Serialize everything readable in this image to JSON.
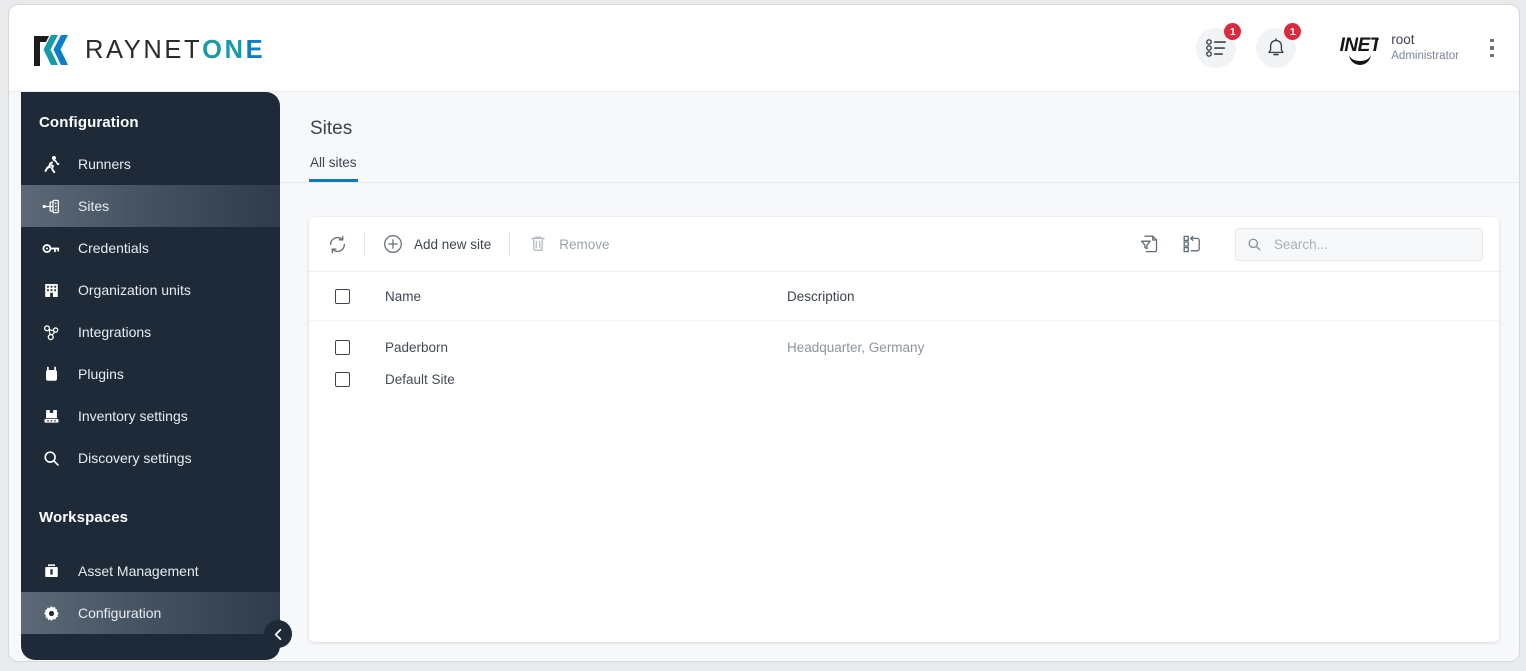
{
  "brand": {
    "name_part1": "RAYNET",
    "name_part2": "ON",
    "name_part3": "E",
    "accent_teal": "#1a9aa8",
    "accent_blue": "#0a7ec8"
  },
  "topbar": {
    "tasks_badge": "1",
    "notifications_badge": "1",
    "avatar_text": "INET",
    "user_name": "root",
    "user_role": "Administrator"
  },
  "sidebar": {
    "sections": [
      {
        "title": "Configuration",
        "items": [
          {
            "label": "Runners",
            "icon": "runner-icon",
            "active": false
          },
          {
            "label": "Sites",
            "icon": "sites-icon",
            "active": true
          },
          {
            "label": "Credentials",
            "icon": "key-icon",
            "active": false
          },
          {
            "label": "Organization units",
            "icon": "building-icon",
            "active": false
          },
          {
            "label": "Integrations",
            "icon": "integrations-icon",
            "active": false
          },
          {
            "label": "Plugins",
            "icon": "plugins-icon",
            "active": false
          },
          {
            "label": "Inventory settings",
            "icon": "inventory-icon",
            "active": false
          },
          {
            "label": "Discovery settings",
            "icon": "search-icon",
            "active": false
          }
        ]
      },
      {
        "title": "Workspaces",
        "items": [
          {
            "label": "Asset Management",
            "icon": "briefcase-icon",
            "active": false
          },
          {
            "label": "Configuration",
            "icon": "gear-icon",
            "active": true
          }
        ]
      }
    ]
  },
  "main": {
    "page_title": "Sites",
    "tabs": [
      {
        "label": "All sites",
        "active": true
      }
    ],
    "toolbar": {
      "refresh_label": "",
      "add_label": "Add new site",
      "remove_label": "Remove",
      "remove_disabled": true
    },
    "search": {
      "placeholder": "Search...",
      "value": ""
    },
    "table": {
      "columns": [
        "Name",
        "Description"
      ],
      "rows": [
        {
          "name": "Paderborn",
          "description": "Headquarter, Germany"
        },
        {
          "name": "Default Site",
          "description": ""
        }
      ]
    }
  }
}
